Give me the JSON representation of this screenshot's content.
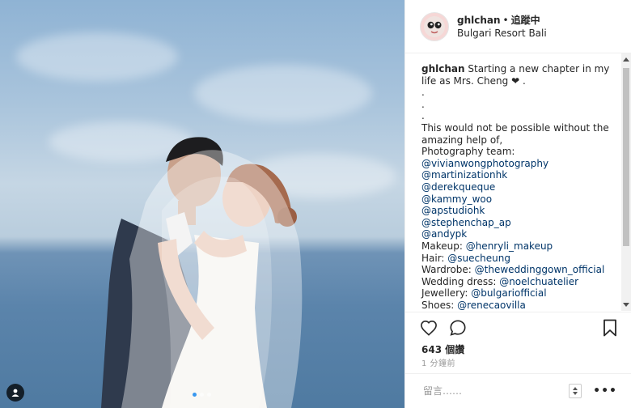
{
  "header": {
    "username": "ghlchan",
    "separator": "•",
    "follow_label": "追蹤中",
    "location": "Bulgari Resort Bali"
  },
  "caption": {
    "username": "ghlchan",
    "first_line": "Starting a new chapter in my",
    "lines": [
      "life as Mrs. Cheng ❤ .",
      ".",
      ".",
      ".",
      "This would not be possible without the",
      "amazing help of,",
      "Photography team:"
    ],
    "mentions": [
      "@vivianwongphotography",
      "@martinizationhk",
      "@derekqueque",
      "@kammy_woo",
      "@apstudiohk",
      "@stephenchap_ap",
      "@andypk"
    ],
    "credits": [
      {
        "label": "Makeup: ",
        "handle": "@henryli_makeup"
      },
      {
        "label": "Hair: ",
        "handle": "@suecheung"
      },
      {
        "label": "Wardrobe: ",
        "handle": "@theweddinggown_official"
      },
      {
        "label": "Wedding dress: ",
        "handle": "@noelchuatelier"
      },
      {
        "label": "Jewellery: ",
        "handle": "@bulgariofficial"
      },
      {
        "label": "Shoes: ",
        "handle": "@renecaovilla"
      }
    ]
  },
  "stats": {
    "likes": "643 個讚",
    "time_ago": "1 分鐘前"
  },
  "comment": {
    "placeholder": "留言……",
    "more_label": "•••"
  },
  "carousel": {
    "count": 3,
    "active": 0
  },
  "icons": {
    "like": "heart-icon",
    "comment": "comment-icon",
    "save": "bookmark-icon",
    "tag": "user-tag-icon"
  },
  "colors": {
    "link": "#003569",
    "active_dot": "#3897f0",
    "muted": "#999999"
  }
}
